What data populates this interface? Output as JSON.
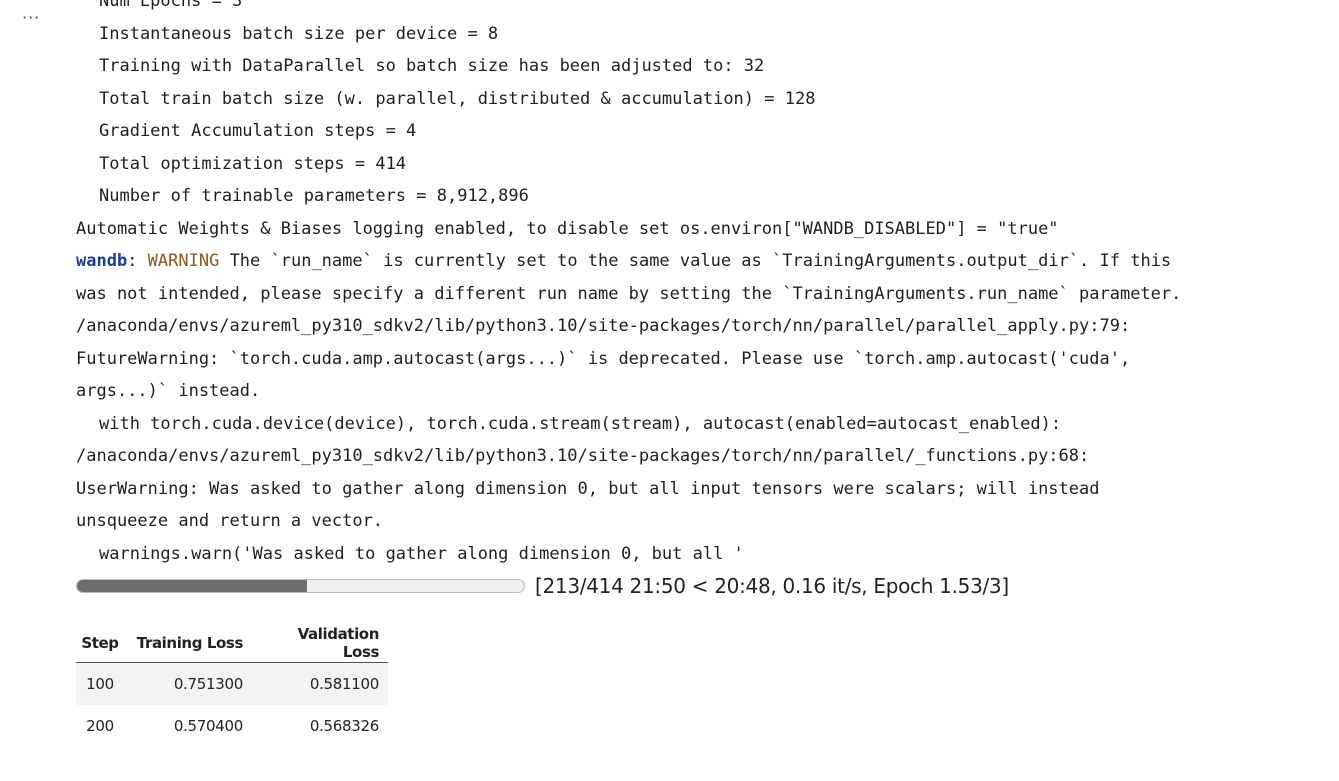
{
  "cell": {
    "more_icon": "···",
    "output_lines": [
      {
        "indent": true,
        "text": "Num Epochs = 3"
      },
      {
        "indent": true,
        "text": "Instantaneous batch size per device = 8"
      },
      {
        "indent": true,
        "text": "Training with DataParallel so batch size has been adjusted to: 32"
      },
      {
        "indent": true,
        "text": "Total train batch size (w. parallel, distributed & accumulation) = 128"
      },
      {
        "indent": true,
        "text": "Gradient Accumulation steps = 4"
      },
      {
        "indent": true,
        "text": "Total optimization steps = 414"
      },
      {
        "indent": true,
        "text": "Number of trainable parameters = 8,912,896"
      },
      {
        "indent": false,
        "text": "Automatic Weights & Biases logging enabled, to disable set os.environ[\"WANDB_DISABLED\"] = \"true\""
      },
      {
        "indent": false,
        "prefix": "wandb",
        "sep": ": ",
        "tag": "WARNING",
        "text": " The `run_name` is currently set to the same value as `TrainingArguments.output_dir`. If this"
      },
      {
        "indent": false,
        "text": "was not intended, please specify a different run name by setting the `TrainingArguments.run_name` parameter."
      },
      {
        "indent": false,
        "text": "/anaconda/envs/azureml_py310_sdkv2/lib/python3.10/site-packages/torch/nn/parallel/parallel_apply.py:79:"
      },
      {
        "indent": false,
        "text": "FutureWarning: `torch.cuda.amp.autocast(args...)` is deprecated. Please use `torch.amp.autocast('cuda',"
      },
      {
        "indent": false,
        "text": "args...)` instead."
      },
      {
        "indent": true,
        "text": "with torch.cuda.device(device), torch.cuda.stream(stream), autocast(enabled=autocast_enabled):"
      },
      {
        "indent": false,
        "text": "/anaconda/envs/azureml_py310_sdkv2/lib/python3.10/site-packages/torch/nn/parallel/_functions.py:68:"
      },
      {
        "indent": false,
        "text": "UserWarning: Was asked to gather along dimension 0, but all input tensors were scalars; will instead"
      },
      {
        "indent": false,
        "text": "unsqueeze and return a vector."
      },
      {
        "indent": true,
        "text": "warnings.warn('Was asked to gather along dimension 0, but all '"
      }
    ]
  },
  "progress": {
    "fraction": 0.5145,
    "label": "[213/414 21:50 < 20:48, 0.16 it/s, Epoch 1.53/3]"
  },
  "metrics_table": {
    "headers": [
      "Step",
      "Training Loss",
      "Validation Loss"
    ],
    "rows": [
      [
        "100",
        "0.751300",
        "0.581100"
      ],
      [
        "200",
        "0.570400",
        "0.568326"
      ]
    ]
  }
}
